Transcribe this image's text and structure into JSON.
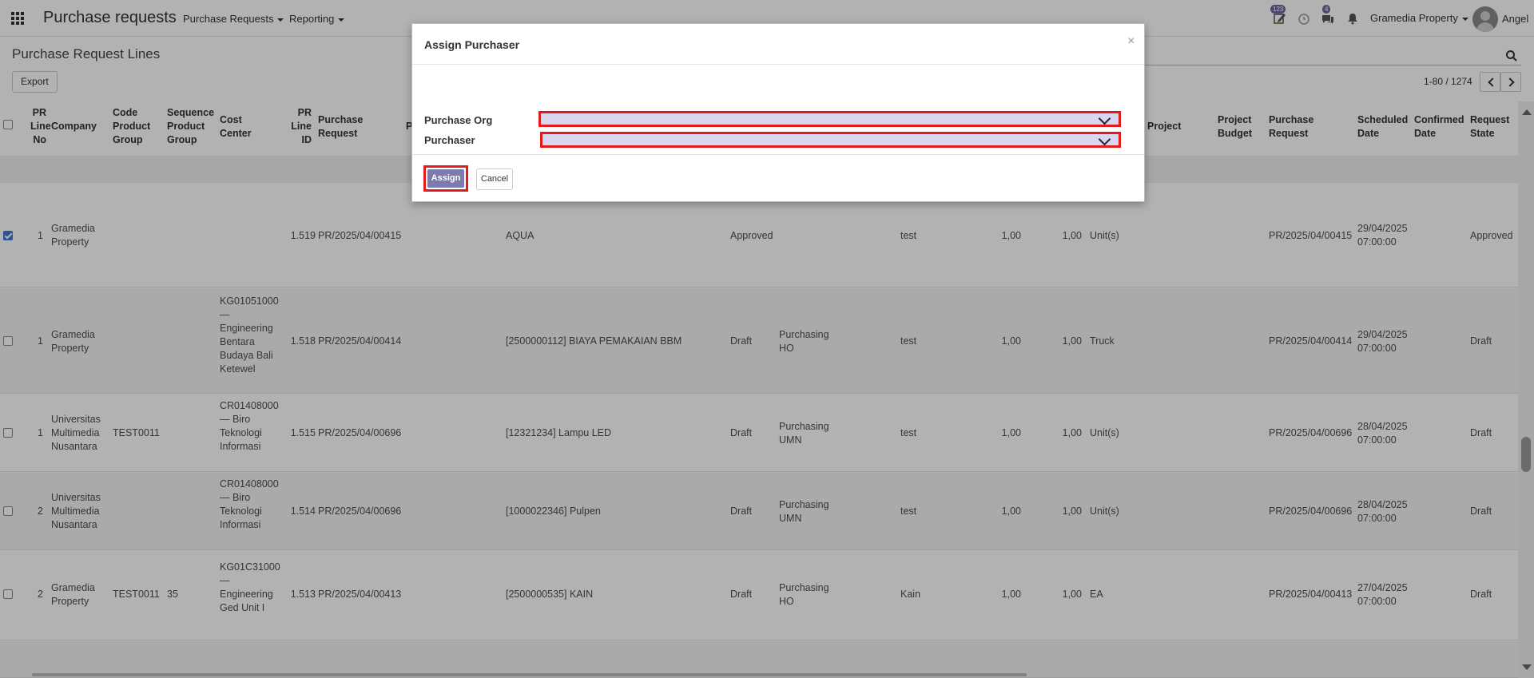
{
  "navbar": {
    "brand": "Purchase requests",
    "menus": [
      {
        "label": "Purchase Requests"
      },
      {
        "label": "Reporting"
      }
    ],
    "activities_badge": "123",
    "messages_badge": "4",
    "company": "Gramedia Property",
    "user": "Angel"
  },
  "control_panel": {
    "title": "Purchase Request Lines",
    "export_label": "Export",
    "pager": "1-80 / 1274"
  },
  "columns": {
    "pr_line_no": "PR Line No",
    "company": "Company",
    "code_product_group": "Code Product Group",
    "sequence_product_group": "Sequence Product Group",
    "cost_center": "Cost Center",
    "pr_line_id": "PR Line ID",
    "purchase_request": "Purchase Request",
    "p_trunc": "P",
    "project": "Project",
    "project_budget": "Project Budget",
    "purchase_request_2": "Purchase Request",
    "scheduled_date": "Scheduled Date",
    "confirmed_date": "Confirmed Date",
    "request_state": "Request State"
  },
  "rows": [
    {
      "checked": true,
      "line_no": "1",
      "company": "Gramedia Property",
      "code": "",
      "seq": "",
      "cost_center": "",
      "line_id": "1.519",
      "pr": "PR/2025/04/00415",
      "product": "AQUA",
      "state": "Approved",
      "purchaser": "",
      "desc": "test",
      "qty": "1,00",
      "qty2": "1,00",
      "uom": "Unit(s)",
      "pr2": "PR/2025/04/00415",
      "sched": "29/04/2025 07:00:00",
      "req_state": "Approved"
    },
    {
      "checked": false,
      "line_no": "1",
      "company": "Gramedia Property",
      "code": "",
      "seq": "",
      "cost_center": "KG01051000 — Engineering Bentara Budaya Bali Ketewel",
      "line_id": "1.518",
      "pr": "PR/2025/04/00414",
      "product": "[2500000112] BIAYA PEMAKAIAN BBM",
      "state": "Draft",
      "purchaser": "Purchasing HO",
      "desc": "test",
      "qty": "1,00",
      "qty2": "1,00",
      "uom": "Truck",
      "pr2": "PR/2025/04/00414",
      "sched": "29/04/2025 07:00:00",
      "req_state": "Draft"
    },
    {
      "checked": false,
      "line_no": "1",
      "company": "Universitas Multimedia Nusantara",
      "code": "TEST0011",
      "seq": "",
      "cost_center": "CR01408000 — Biro Teknologi Informasi",
      "line_id": "1.515",
      "pr": "PR/2025/04/00696",
      "product": "[12321234] Lampu LED",
      "state": "Draft",
      "purchaser": "Purchasing UMN",
      "desc": "test",
      "qty": "1,00",
      "qty2": "1,00",
      "uom": "Unit(s)",
      "pr2": "PR/2025/04/00696",
      "sched": "28/04/2025 07:00:00",
      "req_state": "Draft"
    },
    {
      "checked": false,
      "line_no": "2",
      "company": "Universitas Multimedia Nusantara",
      "code": "",
      "seq": "",
      "cost_center": "CR01408000 — Biro Teknologi Informasi",
      "line_id": "1.514",
      "pr": "PR/2025/04/00696",
      "product": "[1000022346] Pulpen",
      "state": "Draft",
      "purchaser": "Purchasing UMN",
      "desc": "test",
      "qty": "1,00",
      "qty2": "1,00",
      "uom": "Unit(s)",
      "pr2": "PR/2025/04/00696",
      "sched": "28/04/2025 07:00:00",
      "req_state": "Draft"
    },
    {
      "checked": false,
      "line_no": "2",
      "company": "Gramedia Property",
      "code": "TEST0011",
      "seq": "35",
      "cost_center": "KG01C31000 — Engineering Ged Unit I",
      "line_id": "1.513",
      "pr": "PR/2025/04/00413",
      "product": "[2500000535] KAIN",
      "state": "Draft",
      "purchaser": "Purchasing HO",
      "desc": "Kain",
      "qty": "1,00",
      "qty2": "1,00",
      "uom": "EA",
      "pr2": "PR/2025/04/00413",
      "sched": "27/04/2025 07:00:00",
      "req_state": "Draft"
    }
  ],
  "modal": {
    "title": "Assign Purchaser",
    "close": "×",
    "purchase_org_label": "Purchase Org",
    "purchase_org_value": "",
    "purchaser_label": "Purchaser",
    "purchaser_value": "",
    "assign_label": "Assign",
    "cancel_label": "Cancel"
  },
  "colors": {
    "primary": "#7c7bad",
    "highlight": "#e21c1c",
    "select_bg": "#d7d7f0"
  }
}
